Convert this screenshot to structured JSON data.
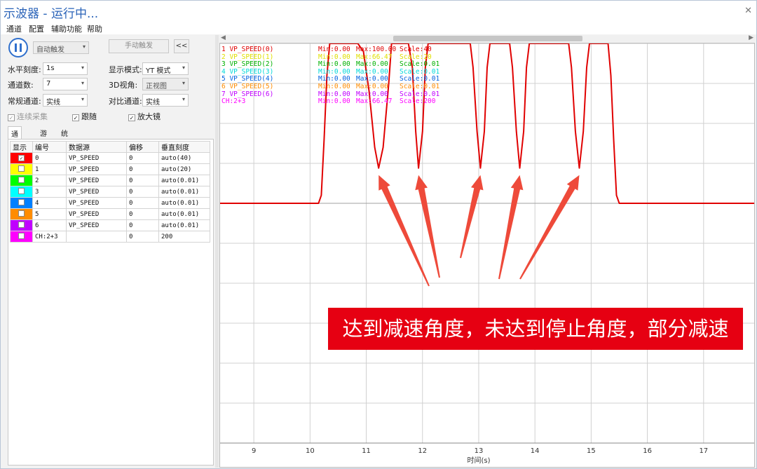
{
  "window": {
    "title": "示波器 - 运行中...",
    "close_icon": "close-icon"
  },
  "menu": [
    "通道",
    "配置",
    "辅助功能",
    "帮助"
  ],
  "controls": {
    "trigger_mode": "自动触发",
    "manual_trigger": "手动触发",
    "collapse": "<<",
    "h_scale_label": "水平刻度:",
    "h_scale_value": "1s",
    "display_mode_label": "显示模式:",
    "display_mode_value": "YT 模式",
    "channel_count_label": "通道数:",
    "channel_count_value": "7",
    "view3d_label": "3D视角:",
    "view3d_value": "正视图",
    "normal_channel_label": "常规通道:",
    "normal_channel_value": "实线",
    "compare_channel_label": "对比通道:",
    "compare_channel_value": "实线",
    "continuous_label": "连续采集",
    "follow_label": "跟随",
    "magnifier_label": "放大镜"
  },
  "tabs": [
    "通道号",
    "游标",
    "统计"
  ],
  "table": {
    "headers": [
      "显示",
      "编号",
      "数据源",
      "偏移",
      "垂直刻度"
    ],
    "rows": [
      {
        "color": "#ff0000",
        "checked": true,
        "id": "0",
        "source": "VP_SPEED",
        "offset": "0",
        "scale": "auto(40)"
      },
      {
        "color": "#ffff00",
        "checked": false,
        "id": "1",
        "source": "VP_SPEED",
        "offset": "0",
        "scale": "auto(20)"
      },
      {
        "color": "#00ff00",
        "checked": false,
        "id": "2",
        "source": "VP_SPEED",
        "offset": "0",
        "scale": "auto(0.01)"
      },
      {
        "color": "#00ffff",
        "checked": false,
        "id": "3",
        "source": "VP_SPEED",
        "offset": "0",
        "scale": "auto(0.01)"
      },
      {
        "color": "#0080ff",
        "checked": false,
        "id": "4",
        "source": "VP_SPEED",
        "offset": "0",
        "scale": "auto(0.01)"
      },
      {
        "color": "#ff8c00",
        "checked": false,
        "id": "5",
        "source": "VP_SPEED",
        "offset": "0",
        "scale": "auto(0.01)"
      },
      {
        "color": "#c000ff",
        "checked": false,
        "id": "6",
        "source": "VP_SPEED",
        "offset": "0",
        "scale": "auto(0.01)"
      },
      {
        "color": "#ff00ff",
        "checked": false,
        "id": "CH:2+3",
        "source": "",
        "offset": "0",
        "scale": "200"
      }
    ]
  },
  "legend": [
    {
      "name": "1 VP_SPEED(0)",
      "min": "Min:0.00",
      "max": "Max:100.00",
      "scale": "Scale:40",
      "color": "#e00000"
    },
    {
      "name": "2 VP_SPEED(1)",
      "min": "Min:0.00",
      "max": "Max:66.47",
      "scale": "Scale:20",
      "color": "#e0e000"
    },
    {
      "name": "3 VP_SPEED(2)",
      "min": "Min:0.00",
      "max": "Max:0.00",
      "scale": "Scale:0.01",
      "color": "#00b000"
    },
    {
      "name": "4 VP_SPEED(3)",
      "min": "Min:0.00",
      "max": "Max:0.00",
      "scale": "Scale:0.01",
      "color": "#00d8d8"
    },
    {
      "name": "5 VP_SPEED(4)",
      "min": "Min:0.00",
      "max": "Max:0.00",
      "scale": "Scale:0.01",
      "color": "#0060e0"
    },
    {
      "name": "6 VP_SPEED(5)",
      "min": "Min:0.00",
      "max": "Max:0.00",
      "scale": "Scale:0.01",
      "color": "#ff8c00"
    },
    {
      "name": "7 VP_SPEED(6)",
      "min": "Min:0.00",
      "max": "Max:0.00",
      "scale": "Scale:0.01",
      "color": "#c000ff"
    },
    {
      "name": "CH:2+3",
      "min": "Min:0.00",
      "max": "Max:66.47",
      "scale": "Scale:200",
      "color": "#ff00ff"
    }
  ],
  "chart_data": {
    "type": "line",
    "xlabel": "时间(s)",
    "xlim": [
      8.4,
      17.9
    ],
    "x_ticks": [
      "9",
      "10",
      "11",
      "12",
      "13",
      "14",
      "15",
      "16",
      "17"
    ],
    "y_range": [
      -150,
      100
    ],
    "series": [
      {
        "name": "1 VP_SPEED(0)",
        "color": "#e00000",
        "points": [
          [
            8.4,
            0
          ],
          [
            10.15,
            0
          ],
          [
            10.2,
            5
          ],
          [
            10.25,
            40
          ],
          [
            10.3,
            80
          ],
          [
            10.35,
            100
          ],
          [
            10.85,
            100
          ],
          [
            10.95,
            95
          ],
          [
            11.05,
            70
          ],
          [
            11.15,
            35
          ],
          [
            11.22,
            22
          ],
          [
            11.3,
            35
          ],
          [
            11.4,
            75
          ],
          [
            11.45,
            100
          ],
          [
            11.75,
            100
          ],
          [
            11.82,
            85
          ],
          [
            11.88,
            45
          ],
          [
            11.93,
            22
          ],
          [
            12.0,
            45
          ],
          [
            12.05,
            85
          ],
          [
            12.1,
            100
          ],
          [
            12.85,
            100
          ],
          [
            12.9,
            85
          ],
          [
            12.97,
            45
          ],
          [
            13.03,
            22
          ],
          [
            13.1,
            45
          ],
          [
            13.15,
            85
          ],
          [
            13.2,
            100
          ],
          [
            13.55,
            100
          ],
          [
            13.6,
            85
          ],
          [
            13.67,
            45
          ],
          [
            13.73,
            22
          ],
          [
            13.8,
            45
          ],
          [
            13.85,
            85
          ],
          [
            13.9,
            100
          ],
          [
            14.6,
            100
          ],
          [
            14.65,
            85
          ],
          [
            14.72,
            45
          ],
          [
            14.79,
            22
          ],
          [
            14.86,
            45
          ],
          [
            14.92,
            85
          ],
          [
            14.97,
            100
          ],
          [
            15.3,
            100
          ],
          [
            15.35,
            80
          ],
          [
            15.4,
            40
          ],
          [
            15.45,
            5
          ],
          [
            15.5,
            0
          ],
          [
            17.9,
            0
          ]
        ]
      }
    ]
  },
  "annotation": {
    "text": "达到减速角度，未达到停止角度，部分减速"
  }
}
